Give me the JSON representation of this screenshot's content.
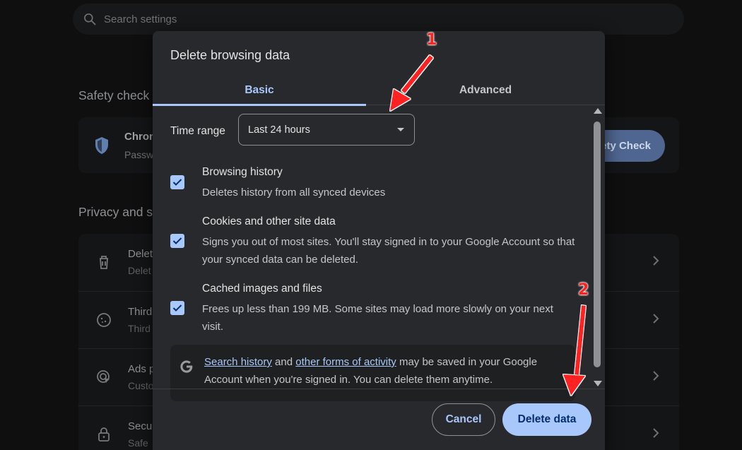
{
  "background": {
    "search_placeholder": "Search settings",
    "safety_section_title": "Safety check",
    "safety_card_title": "Chron",
    "safety_card_subtitle": "Passw",
    "safety_button_label": "ety Check",
    "privacy_section_title": "Privacy and s",
    "privacy_rows": [
      {
        "title": "Delet",
        "subtitle": "Delet",
        "icon": "trash-icon"
      },
      {
        "title": "Third",
        "subtitle": "Third",
        "icon": "cookie-icon"
      },
      {
        "title": "Ads p",
        "subtitle": "Custo",
        "icon": "ads-icon"
      },
      {
        "title": "Secu",
        "subtitle": "Safe",
        "icon": "lock-icon"
      }
    ]
  },
  "dialog": {
    "title": "Delete browsing data",
    "tabs": [
      {
        "label": "Basic",
        "active": true
      },
      {
        "label": "Advanced",
        "active": false
      }
    ],
    "time_range": {
      "label": "Time range",
      "selected": "Last 24 hours"
    },
    "options": [
      {
        "title": "Browsing history",
        "description": "Deletes history from all synced devices",
        "checked": true
      },
      {
        "title": "Cookies and other site data",
        "description": "Signs you out of most sites. You'll stay signed in to your Google Account so that your synced data can be deleted.",
        "checked": true
      },
      {
        "title": "Cached images and files",
        "description": "Frees up less than 199 MB. Some sites may load more slowly on your next visit.",
        "checked": true
      }
    ],
    "info": {
      "link1": "Search history",
      "text1": " and ",
      "link2": "other forms of activity",
      "text2": " may be saved in your Google Account when you're signed in. You can delete them anytime."
    },
    "buttons": {
      "cancel": "Cancel",
      "delete": "Delete data"
    }
  },
  "annotations": [
    {
      "label": "1"
    },
    {
      "label": "2"
    }
  ],
  "colors": {
    "accent": "#a8c7fa",
    "dialog_bg": "#28292c",
    "annotation": "#ff2020"
  }
}
